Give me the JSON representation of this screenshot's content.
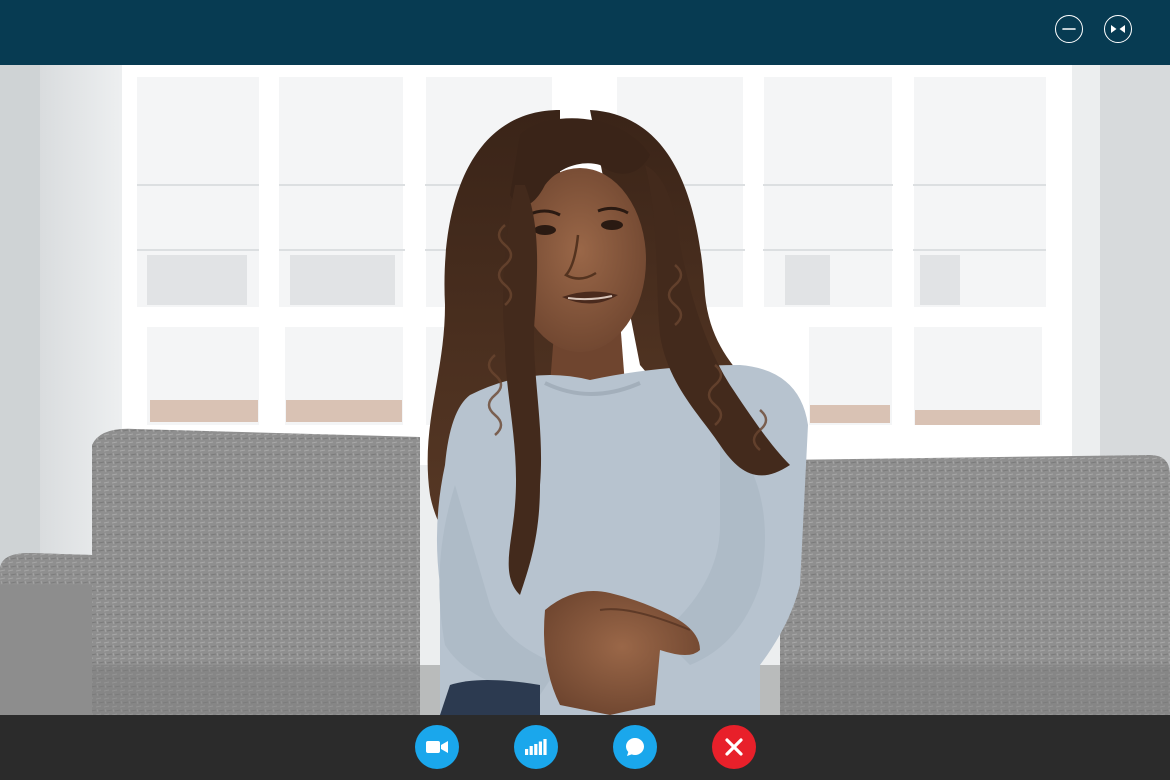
{
  "window": {
    "title_bar_color": "#073b52",
    "controls": [
      {
        "id": "minimize",
        "icon": "minimize-icon"
      },
      {
        "id": "restore",
        "icon": "collapse-arrows-icon"
      }
    ]
  },
  "video_feed": {
    "description_icon": "participant-video",
    "scene": "woman-on-sofa-video-call"
  },
  "call_controls": {
    "bar_color": "#2b2b2b",
    "buttons": [
      {
        "id": "video",
        "icon": "video-camera-icon",
        "color": "#1aa7ec"
      },
      {
        "id": "stats",
        "icon": "signal-bars-icon",
        "color": "#1aa7ec"
      },
      {
        "id": "chat",
        "icon": "chat-bubble-icon",
        "color": "#1aa7ec"
      },
      {
        "id": "end-call",
        "icon": "close-x-icon",
        "color": "#e8202a"
      }
    ]
  }
}
